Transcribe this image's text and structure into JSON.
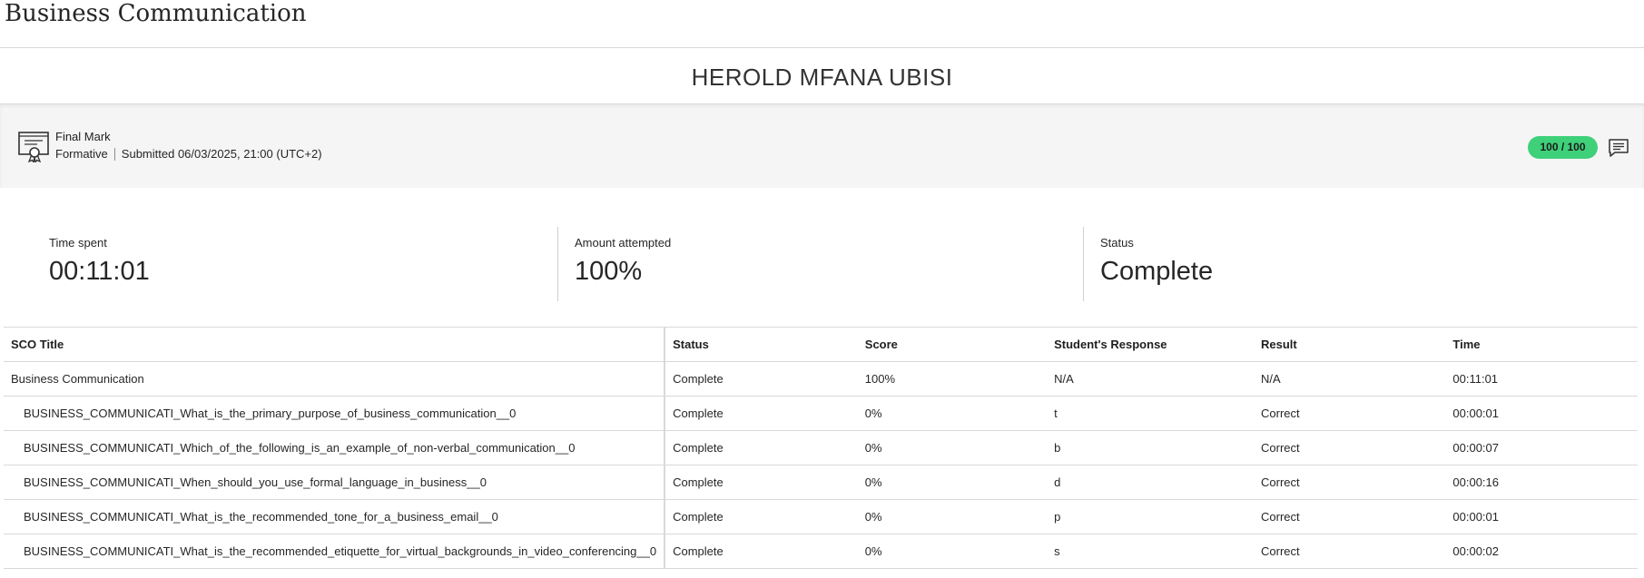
{
  "course": {
    "title": "Business Communication"
  },
  "student": {
    "name": "HEROLD MFANA UBISI"
  },
  "final_mark": {
    "title": "Final Mark",
    "type": "Formative",
    "submitted": "Submitted 06/03/2025, 21:00 (UTC+2)",
    "score": "100 / 100",
    "icon": "certificate-icon",
    "feedback_icon": "feedback-icon",
    "score_color": "#3fd07a"
  },
  "stats": {
    "time_spent_label": "Time spent",
    "time_spent_value": "00:11:01",
    "amount_label": "Amount attempted",
    "amount_value": "100%",
    "status_label": "Status",
    "status_value": "Complete"
  },
  "table": {
    "headers": [
      "SCO Title",
      "Status",
      "Score",
      "Student's Response",
      "Result",
      "Time"
    ],
    "rows": [
      [
        "Business Communication",
        "Complete",
        "100%",
        "N/A",
        "N/A",
        "00:11:01"
      ],
      [
        "BUSINESS_COMMUNICATI_What_is_the_primary_purpose_of_business_communication__0",
        "Complete",
        "0%",
        "t",
        "Correct",
        "00:00:01"
      ],
      [
        "BUSINESS_COMMUNICATI_Which_of_the_following_is_an_example_of_non-verbal_communication__0",
        "Complete",
        "0%",
        "b",
        "Correct",
        "00:00:07"
      ],
      [
        "BUSINESS_COMMUNICATI_When_should_you_use_formal_language_in_business__0",
        "Complete",
        "0%",
        "d",
        "Correct",
        "00:00:16"
      ],
      [
        "BUSINESS_COMMUNICATI_What_is_the_recommended_tone_for_a_business_email__0",
        "Complete",
        "0%",
        "p",
        "Correct",
        "00:00:01"
      ],
      [
        "BUSINESS_COMMUNICATI_What_is_the_recommended_etiquette_for_virtual_backgrounds_in_video_conferencing__0",
        "Complete",
        "0%",
        "s",
        "Correct",
        "00:00:02"
      ]
    ]
  }
}
